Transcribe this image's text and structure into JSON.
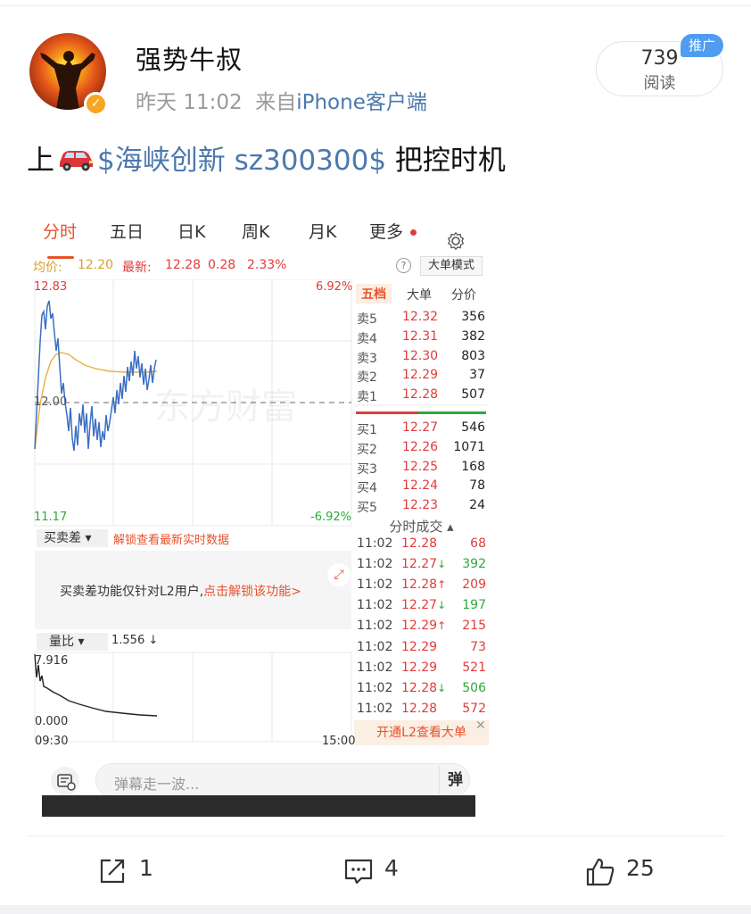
{
  "post": {
    "username": "强势牛叔",
    "time": "昨天 11:02",
    "from_prefix": "来自",
    "source": "iPhone客户端",
    "read_count": "739",
    "read_label": "阅读",
    "promo_badge": "推广",
    "text_before": "上",
    "stock_tag": "$海峡创新 sz300300$",
    "text_after": "把控时机"
  },
  "app_screenshot": {
    "tabs": [
      "分时",
      "五日",
      "日K",
      "周K",
      "月K",
      "更多"
    ],
    "active_tab": "分时",
    "avg_label": "均价:",
    "avg_value": "12.20",
    "last_label": "最新:",
    "last_value": "12.28",
    "change": "0.28",
    "change_pct": "2.33%",
    "help_icon": "?",
    "big_order_mode": "大单模式",
    "price_high": "12.83",
    "price_mid": "12.00",
    "price_low": "11.17",
    "pct_high": "6.92%",
    "pct_low": "-6.92%",
    "watermark": "东方财富",
    "orderbook_tabs": [
      "五档",
      "大单",
      "分价"
    ],
    "asks": [
      {
        "label": "卖5",
        "price": "12.32",
        "volume": "356"
      },
      {
        "label": "卖4",
        "price": "12.31",
        "volume": "382"
      },
      {
        "label": "卖3",
        "price": "12.30",
        "volume": "803"
      },
      {
        "label": "卖2",
        "price": "12.29",
        "volume": "37"
      },
      {
        "label": "卖1",
        "price": "12.28",
        "volume": "507"
      }
    ],
    "bids": [
      {
        "label": "买1",
        "price": "12.27",
        "volume": "546"
      },
      {
        "label": "买2",
        "price": "12.26",
        "volume": "1071"
      },
      {
        "label": "买3",
        "price": "12.25",
        "volume": "168"
      },
      {
        "label": "买4",
        "price": "12.24",
        "volume": "78"
      },
      {
        "label": "买5",
        "price": "12.23",
        "volume": "24"
      }
    ],
    "trades_title": "分时成交 ▴",
    "trades": [
      {
        "time": "11:02",
        "price": "12.28",
        "arrow": "",
        "volume": "68",
        "color": "#e23b3b"
      },
      {
        "time": "11:02",
        "price": "12.27",
        "arrow": "↓",
        "volume": "392",
        "color": "#2daa3a"
      },
      {
        "time": "11:02",
        "price": "12.28",
        "arrow": "↑",
        "volume": "209",
        "color": "#e23b3b"
      },
      {
        "time": "11:02",
        "price": "12.27",
        "arrow": "↓",
        "volume": "197",
        "color": "#2daa3a"
      },
      {
        "time": "11:02",
        "price": "12.29",
        "arrow": "↑",
        "volume": "215",
        "color": "#e23b3b"
      },
      {
        "time": "11:02",
        "price": "12.29",
        "arrow": "",
        "volume": "73",
        "color": "#e23b3b"
      },
      {
        "time": "11:02",
        "price": "12.29",
        "arrow": "",
        "volume": "521",
        "color": "#e23b3b"
      },
      {
        "time": "11:02",
        "price": "12.28",
        "arrow": "↓",
        "volume": "506",
        "color": "#2daa3a"
      },
      {
        "time": "11:02",
        "price": "12.28",
        "arrow": "",
        "volume": "572",
        "color": "#e23b3b"
      }
    ],
    "l2_banner": "开通L2查看大单",
    "spread_select": "买卖差 ▾",
    "spread_unlock": "解锁查看最新实时数据",
    "spread_msg": "买卖差功能仅针对L2用户,",
    "spread_cta": "点击解锁该功能>",
    "vol_select": "量比 ▾",
    "vol_value": "1.556 ↓",
    "vol_top": "7.916",
    "vol_bottom": "0.000",
    "time_start": "09:30",
    "time_end": "15:00",
    "danmu_placeholder": "弹幕走一波...",
    "danmu_button": "弹"
  },
  "actions": {
    "share_count": "1",
    "comment_count": "4",
    "like_count": "25"
  },
  "colors": {
    "link": "#4c78ae",
    "up": "#e23b3b",
    "down": "#2daa3a",
    "accent": "#e7522c",
    "avg_line": "#e8b23a",
    "price_line": "#3b6fc4"
  }
}
